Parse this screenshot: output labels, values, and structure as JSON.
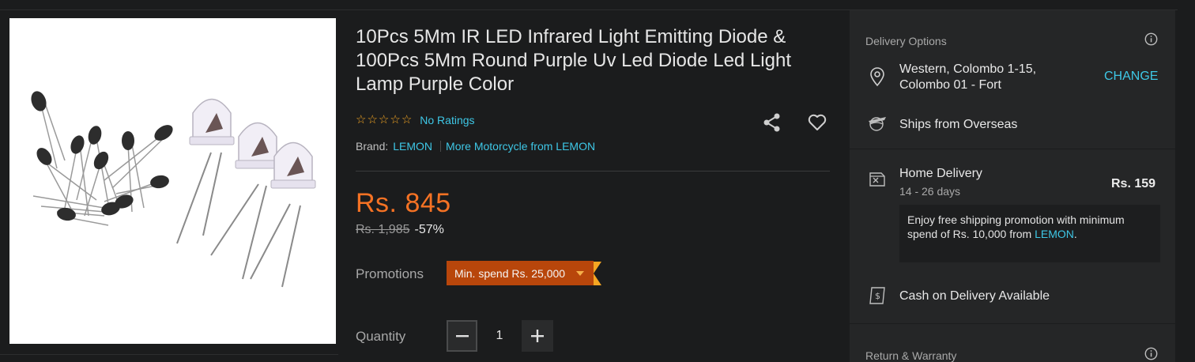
{
  "product": {
    "title": "10Pcs 5Mm IR LED Infrared Light Emitting Diode & 100Pcs 5Mm Round Purple Uv Led Diode Led Light Lamp Purple Color",
    "stars": [
      "☆",
      "☆",
      "☆",
      "☆",
      "☆"
    ],
    "ratings_text": "No Ratings",
    "brand_label": "Brand:",
    "brand_name": "LEMON",
    "more_from": "More Motorcycle from LEMON",
    "price": "Rs. 845",
    "original_price": "Rs. 1,985",
    "discount": "-57%",
    "promotions_label": "Promotions",
    "promotion_tag": "Min. spend Rs. 25,000",
    "quantity_label": "Quantity",
    "quantity_value": "1",
    "accent_color": "#f57224",
    "link_color": "#3ec7e6"
  },
  "icons": {
    "share": "share-icon",
    "wishlist": "heart-icon",
    "location": "location-pin-icon",
    "overseas": "globe-plane-icon",
    "delivery": "package-icon",
    "cash": "cash-receipt-icon",
    "info": "info-icon"
  },
  "delivery": {
    "heading": "Delivery Options",
    "location_line1": "Western, Colombo 1-15,",
    "location_line2": "Colombo 01 - Fort",
    "change_label": "CHANGE",
    "ships_from": "Ships from Overseas",
    "home_delivery": "Home Delivery",
    "home_delivery_days": "14 - 26 days",
    "home_delivery_fee": "Rs. 159",
    "promo_text": "Enjoy free shipping promotion with minimum spend of Rs. 10,000 from",
    "promo_link": "LEMON",
    "promo_end": ".",
    "cod": "Cash on Delivery Available"
  },
  "warranty": {
    "heading": "Return & Warranty"
  }
}
